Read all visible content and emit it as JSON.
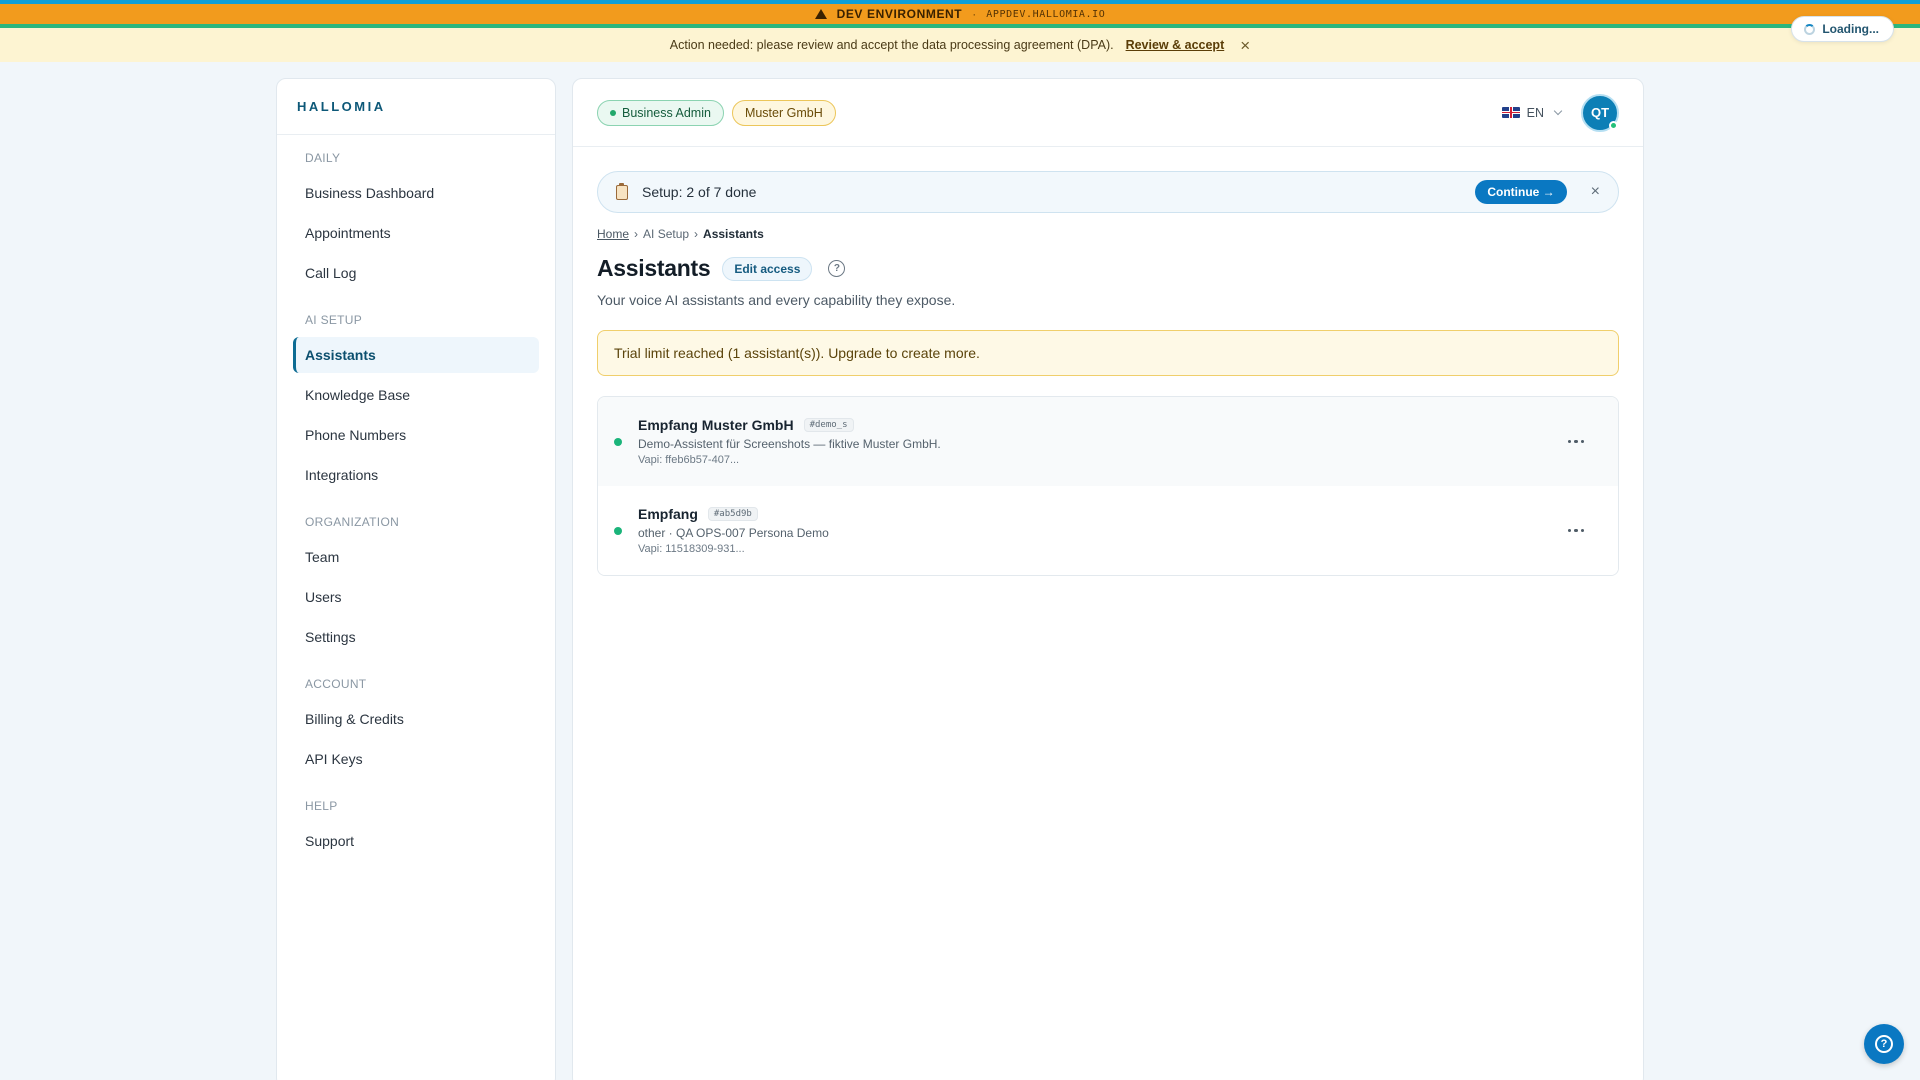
{
  "dev_bar": {
    "label": "DEV ENVIRONMENT",
    "separator": "·",
    "host": "APPDEV.HALLOMIA.IO",
    "warning_icon": "warning-triangle-icon"
  },
  "action_banner": {
    "message": "Action needed: please review and accept the data processing agreement (DPA).",
    "link_label": "Review & accept",
    "close_glyph": "×"
  },
  "loading": {
    "label": "Loading..."
  },
  "sidebar": {
    "brand": "HALLOMIA",
    "sections": {
      "daily": "DAILY",
      "ai_setup": "AI SETUP",
      "organization": "ORGANIZATION",
      "account": "ACCOUNT",
      "help": "HELP"
    },
    "items": {
      "business_dashboard": "Business Dashboard",
      "appointments": "Appointments",
      "call_log": "Call Log",
      "assistants": "Assistants",
      "knowledge_base": "Knowledge Base",
      "phone_numbers": "Phone Numbers",
      "integrations": "Integrations",
      "team": "Team",
      "users": "Users",
      "settings": "Settings",
      "billing_credits": "Billing & Credits",
      "api_keys": "API Keys",
      "support": "Support"
    },
    "active": "assistants"
  },
  "header": {
    "role_chip": "Business Admin",
    "org_chip": "Muster GmbH",
    "language": "EN",
    "avatar_initials": "QT"
  },
  "setup": {
    "text": "Setup: 2 of 7 done",
    "continue_label": "Continue →",
    "close_glyph": "×"
  },
  "breadcrumb": {
    "home": "Home",
    "ai_setup": "AI Setup",
    "current": "Assistants",
    "separator": "›"
  },
  "page": {
    "title": "Assistants",
    "edit_access_label": "Edit access",
    "help_glyph": "?",
    "subtitle": "Your voice AI assistants and every capability they expose."
  },
  "trial_alert": {
    "message": "Trial limit reached (1 assistant(s)). Upgrade to create more."
  },
  "assistants": [
    {
      "name": "Empfang Muster GmbH",
      "tag": "#demo_s",
      "description": "Demo-Assistent für Screenshots — fiktive Muster GmbH.",
      "vapi": "Vapi: ffeb6b57-407...",
      "status_color": "#1bb47a"
    },
    {
      "name": "Empfang",
      "tag": "#ab5d9b",
      "description": "other · QA OPS-007 Persona Demo",
      "vapi": "Vapi: 11518309-931...",
      "status_color": "#1bb47a"
    }
  ],
  "help_fab": {
    "glyph": "?"
  },
  "colors": {
    "accent": "#0a78c2",
    "dev_bar": "#f29b1d",
    "banner": "#fdf4d2",
    "success": "#1bb47a"
  }
}
